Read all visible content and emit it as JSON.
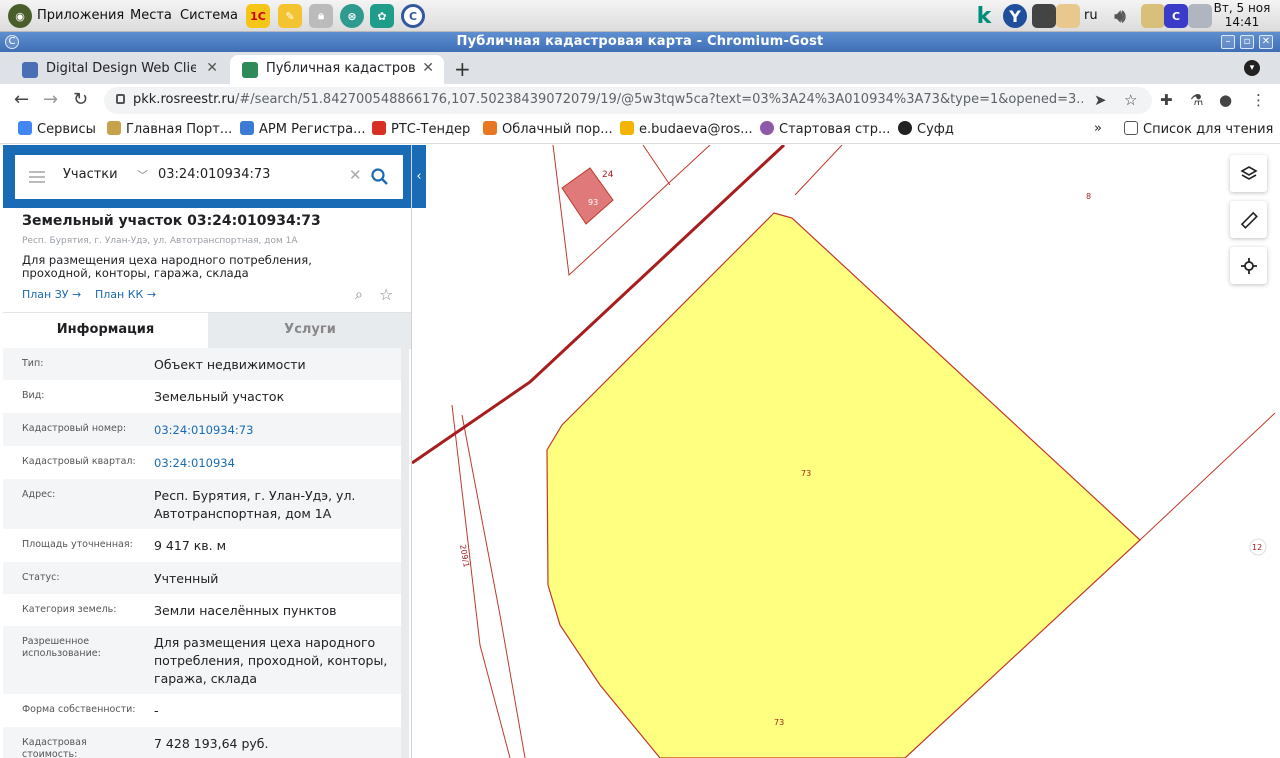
{
  "os_panel": {
    "menus": [
      "Приложения",
      "Места",
      "Система"
    ],
    "lang": "ru",
    "clock": {
      "day": "Вт,  5 ноя",
      "time": "14:41"
    }
  },
  "window": {
    "title": "Публичная кадастровая карта - Chromium-Gost"
  },
  "tabs": [
    {
      "label": "Digital Design Web Client"
    },
    {
      "label": "Публичная кадастровая карта"
    }
  ],
  "address": {
    "domain": "pkk.rosreestr.ru",
    "path": "/#/search/51.842700548866176,107.50238439072079/19/@5w3tqw5ca?text=03%3A24%3A010934%3A73&type=1&opened=3..."
  },
  "bookmarks": [
    {
      "label": "Сервисы",
      "color": "#4285f4"
    },
    {
      "label": "Главная Порт...",
      "color": "#c8a24b"
    },
    {
      "label": "АРМ Регистра...",
      "color": "#3a7bd5"
    },
    {
      "label": "РТС-Тендер",
      "color": "#d93025"
    },
    {
      "label": "Облачный пор...",
      "color": "#e87722"
    },
    {
      "label": "e.budaeva@ros...",
      "color": "#f4b400"
    },
    {
      "label": "Стартовая стр...",
      "color": "#8e5aa8"
    },
    {
      "label": "Суфд",
      "color": "#222222"
    }
  ],
  "bookmarks_more": "»",
  "reading_list": "Список для чтения",
  "search": {
    "type": "Участки",
    "query": "03:24:010934:73"
  },
  "object": {
    "title": "Земельный участок 03:24:010934:73",
    "address": "Респ. Бурятия, г. Улан-Удэ, ул. Автотранспортная, дом 1А",
    "description": "Для размещения цеха народного потребления, проходной, конторы, гаража, склада",
    "plan_zu": "План ЗУ",
    "plan_kk": "План КК"
  },
  "info_tabs": {
    "info": "Информация",
    "services": "Услуги"
  },
  "fields": [
    {
      "k": "Тип:",
      "v": "Объект недвижимости"
    },
    {
      "k": "Вид:",
      "v": "Земельный участок"
    },
    {
      "k": "Кадастровый номер:",
      "v": "03:24:010934:73",
      "link": true
    },
    {
      "k": "Кадастровый квартал:",
      "v": "03:24:010934",
      "link": true
    },
    {
      "k": "Адрес:",
      "v": "Респ. Бурятия, г. Улан-Удэ, ул. Автотранспортная, дом 1А"
    },
    {
      "k": "Площадь уточненная:",
      "v": "9 417 кв. м"
    },
    {
      "k": "Статус:",
      "v": "Учтенный"
    },
    {
      "k": "Категория земель:",
      "v": "Земли населённых пунктов"
    },
    {
      "k": "Разрешенное использование:",
      "v": "Для размещения цеха народного потребления, проходной, конторы, гаража, склада"
    },
    {
      "k": "Форма собственности:",
      "v": "-"
    },
    {
      "k": "Кадастровая стоимость:",
      "v": "7 428 193,64 руб."
    }
  ],
  "map_labels": {
    "p24": "24",
    "p93": "93",
    "p8": "8",
    "p73a": "73",
    "p73b": "73",
    "p12": "12",
    "road": "209/1"
  },
  "colors": {
    "parcel_fill": "#ffff80",
    "parcel_stroke": "#c0392b",
    "selected_fill": "#e07a7a",
    "accent": "#1a6bb5"
  }
}
